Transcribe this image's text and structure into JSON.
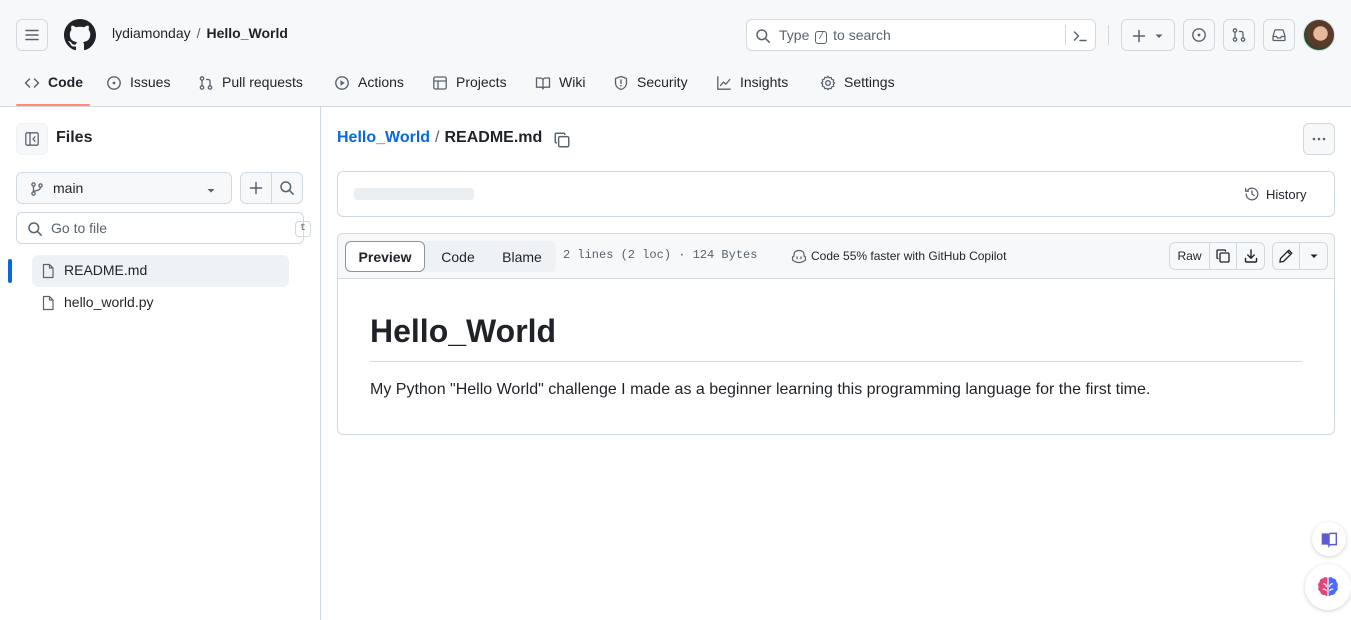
{
  "header": {
    "owner": "lydiamonday",
    "path_sep": "/",
    "repo": "Hello_World",
    "search": {
      "prefix": "Type",
      "key": "/",
      "suffix": "to search"
    }
  },
  "nav": {
    "tabs": [
      {
        "label": "Code",
        "icon": "code-icon",
        "selected": true
      },
      {
        "label": "Issues",
        "icon": "issue-icon"
      },
      {
        "label": "Pull requests",
        "icon": "pull-request-icon"
      },
      {
        "label": "Actions",
        "icon": "play-icon"
      },
      {
        "label": "Projects",
        "icon": "table-icon"
      },
      {
        "label": "Wiki",
        "icon": "book-icon"
      },
      {
        "label": "Security",
        "icon": "shield-icon"
      },
      {
        "label": "Insights",
        "icon": "graph-icon"
      },
      {
        "label": "Settings",
        "icon": "gear-icon"
      }
    ]
  },
  "sidebar": {
    "title": "Files",
    "branch": "main",
    "goto_placeholder": "Go to file",
    "goto_key": "t",
    "files": [
      {
        "name": "README.md",
        "active": true
      },
      {
        "name": "hello_world.py",
        "active": false
      }
    ]
  },
  "main": {
    "breadcrumb": {
      "repo": "Hello_World",
      "sep": "/",
      "file": "README.md"
    },
    "history_label": "History",
    "view_tabs": {
      "preview": "Preview",
      "code": "Code",
      "blame": "Blame"
    },
    "file_meta": "2 lines (2 loc) · 124 Bytes",
    "copilot_label": "Code 55% faster with GitHub Copilot",
    "raw_label": "Raw",
    "readme": {
      "heading": "Hello_World",
      "paragraph": "My Python \"Hello World\" challenge I made as a beginner learning this programming language for the first time."
    }
  },
  "colors": {
    "accent": "#0969da",
    "tab_underline": "#fd8c73",
    "header_bg": "#f6f8fa",
    "border": "#d1d9e0"
  }
}
